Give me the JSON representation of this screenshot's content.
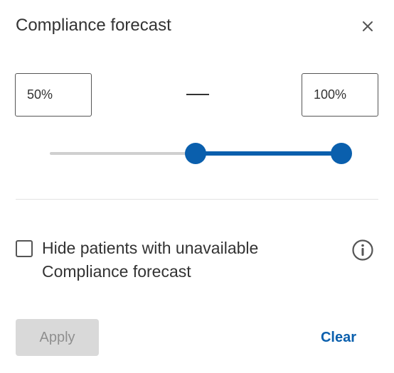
{
  "header": {
    "title": "Compliance forecast",
    "close_icon": "close-icon"
  },
  "range": {
    "min_value": "50%",
    "max_value": "100%",
    "separator": "—"
  },
  "slider": {
    "min_percent": 50,
    "max_percent": 100,
    "track_color": "#cfcfcf",
    "fill_color": "#0a5fad"
  },
  "hide_unavailable": {
    "checked": false,
    "label": "Hide patients with unavailable Compliance forecast",
    "info_icon": "info-icon"
  },
  "footer": {
    "apply_label": "Apply",
    "apply_enabled": false,
    "clear_label": "Clear"
  },
  "colors": {
    "accent": "#0a5fad",
    "disabled_bg": "#d9d9d9",
    "disabled_text": "#8f8f8f"
  }
}
